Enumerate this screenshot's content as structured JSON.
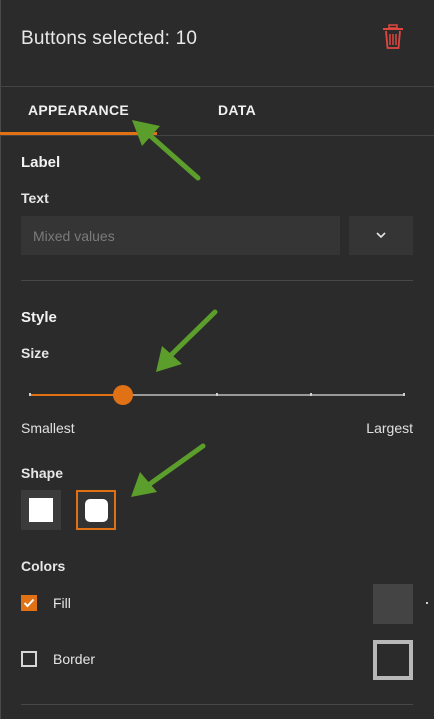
{
  "header": {
    "title": "Buttons selected: 10",
    "delete_icon": "trash-icon",
    "delete_color": "#e0483f"
  },
  "tabs": [
    {
      "label": "APPEARANCE",
      "active": true
    },
    {
      "label": "DATA",
      "active": false
    }
  ],
  "label_section": {
    "title": "Label",
    "text_label": "Text",
    "text_placeholder": "Mixed values",
    "dropdown_icon": "chevron-down-icon"
  },
  "style_section": {
    "title": "Style",
    "size_label": "Size",
    "size_min_label": "Smallest",
    "size_max_label": "Largest",
    "size_level": 0.25,
    "size_steps": 5,
    "shape_label": "Shape",
    "shapes": [
      {
        "name": "square",
        "selected": false
      },
      {
        "name": "rounded",
        "selected": true
      }
    ]
  },
  "colors_section": {
    "title": "Colors",
    "fill_label": "Fill",
    "fill_checked": true,
    "fill_color": "#444444",
    "border_label": "Border",
    "border_checked": false,
    "border_color": "#b8b8b8"
  },
  "accent_color": "#e07115",
  "annotation_color": "#5c9e2b"
}
